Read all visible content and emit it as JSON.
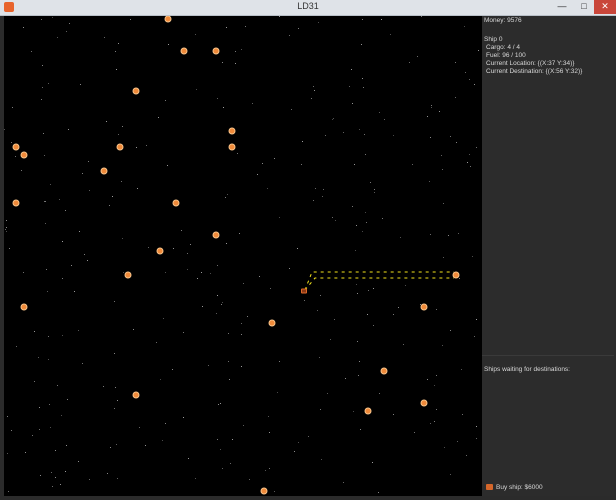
{
  "window": {
    "title": "LD31",
    "minimize_glyph": "—",
    "maximize_glyph": "□",
    "close_glyph": "✕"
  },
  "panel": {
    "money": "Money: 9576",
    "ship": {
      "name": "Ship 0",
      "cargo": "Cargo: 4 / 4",
      "fuel": "Fuel: 96 / 100",
      "location": "Current Location: {(X:37 Y:34)}",
      "destination": "Current Destination: {(X:56 Y:32)}"
    },
    "waiting": "Ships waiting for destinations:",
    "buy_ship": "Buy ship: $6000"
  },
  "colors": {
    "planet": "#f08a3a",
    "route": "#f2e21b",
    "panel_bg": "#2c2c2c",
    "space_bg": "#000000"
  },
  "icons": {
    "planet": "orange-planet-icon",
    "ship": "ship-icon"
  }
}
